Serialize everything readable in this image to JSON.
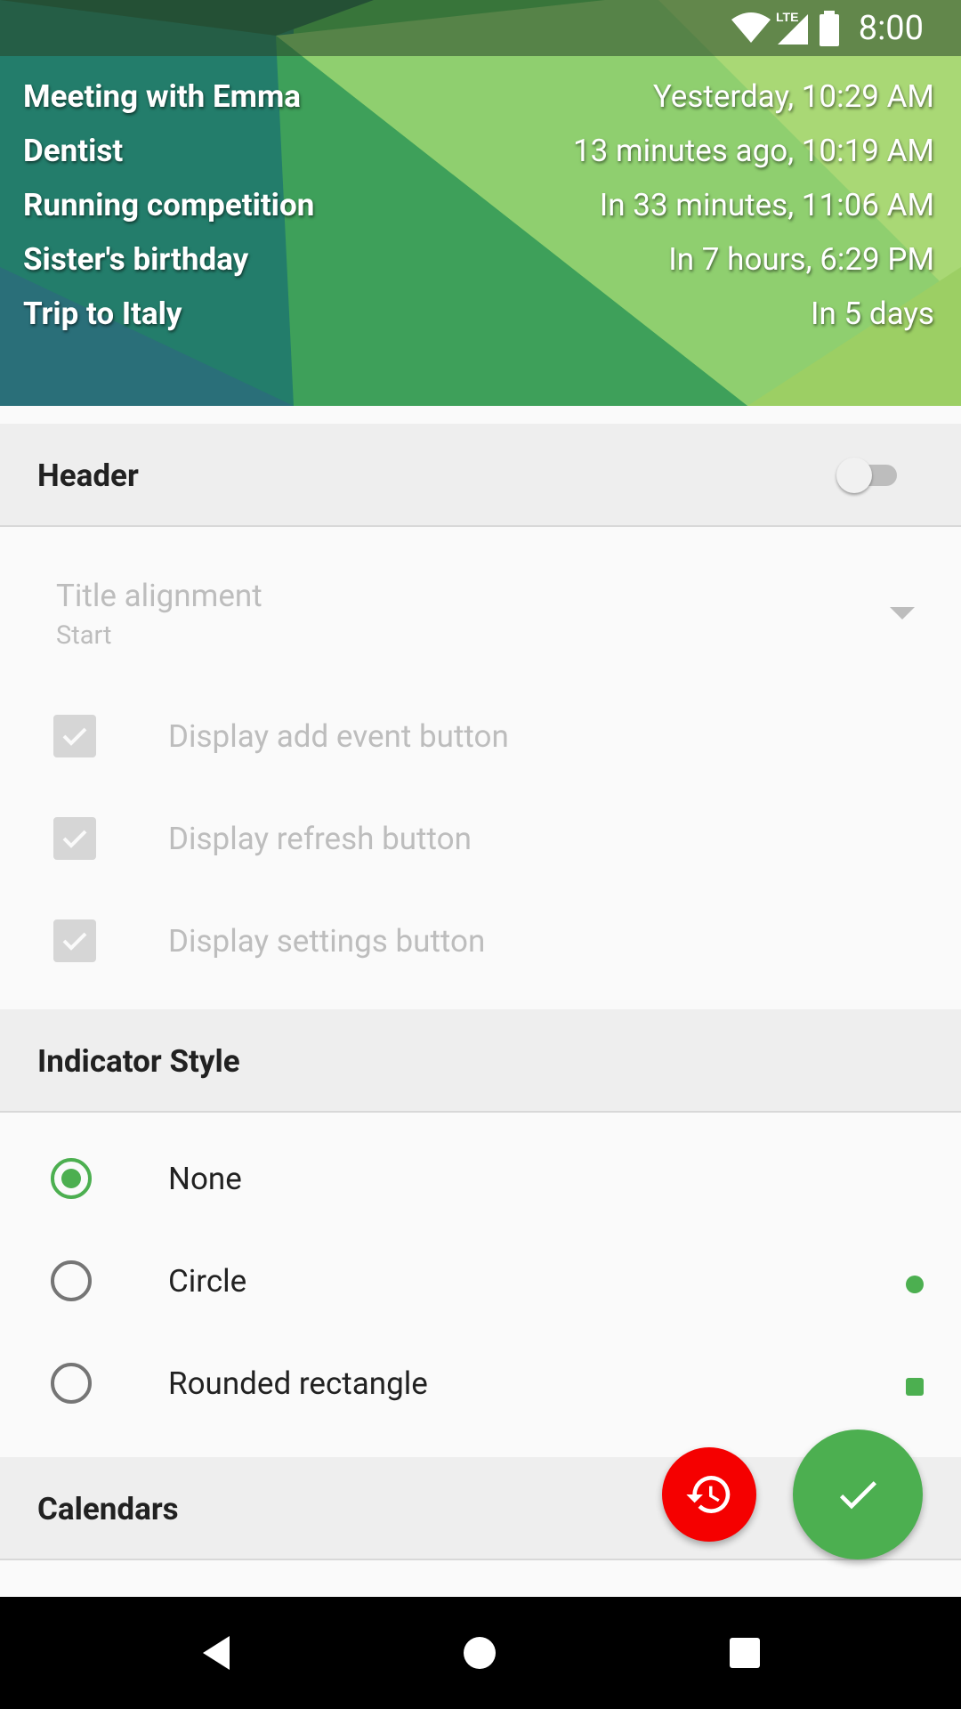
{
  "status_bar": {
    "time": "8:00",
    "icons": [
      "wifi-icon",
      "lte-signal-icon",
      "battery-icon"
    ]
  },
  "widget": {
    "events": [
      {
        "title": "Meeting with Emma",
        "time": "Yesterday, 10:29 AM"
      },
      {
        "title": "Dentist",
        "time": "13 minutes ago, 10:19 AM"
      },
      {
        "title": "Running competition",
        "time": "In 33 minutes, 11:06 AM"
      },
      {
        "title": "Sister's birthday",
        "time": "In 7 hours, 6:29 PM"
      },
      {
        "title": "Trip to Italy",
        "time": "In 5 days"
      }
    ]
  },
  "header_section": {
    "title": "Header",
    "toggle_on": false
  },
  "title_alignment": {
    "title": "Title alignment",
    "summary": "Start"
  },
  "checkboxes": [
    {
      "label": "Display add event button",
      "checked": true,
      "enabled": false
    },
    {
      "label": "Display refresh button",
      "checked": true,
      "enabled": false
    },
    {
      "label": "Display settings button",
      "checked": true,
      "enabled": false
    }
  ],
  "indicator_section": {
    "title": "Indicator Style"
  },
  "indicator_options": [
    {
      "label": "None",
      "selected": true
    },
    {
      "label": "Circle",
      "selected": false
    },
    {
      "label": "Rounded rectangle",
      "selected": false
    }
  ],
  "calendars_section": {
    "title": "Calendars"
  },
  "fabs": {
    "reset_icon": "history-icon",
    "save_icon": "check-icon"
  },
  "colors": {
    "accent": "#4caf50",
    "reset_fab": "#f50000"
  },
  "nav_bar": {
    "icons": [
      "back-icon",
      "home-icon",
      "recents-icon"
    ]
  }
}
